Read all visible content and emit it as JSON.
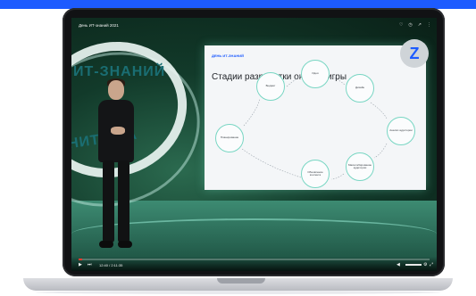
{
  "video": {
    "title": "День ИТ-знаний 2021",
    "time": "12:40 / 2:11:35",
    "progress_fraction": 0.01
  },
  "scene": {
    "ring_text_top": "ИТ-ЗНАНИЙ",
    "ring_text_bottom": "НИТ-ЗНА"
  },
  "slide": {
    "brand": "ДЕНЬ ИТ-ЗНАНИЙ",
    "title": "Стадии разработки онлайн-игры",
    "nodes": {
      "idea": "Идея",
      "budget": "Бюджет",
      "design": "Дизайн",
      "audience": "Анализ аудитории",
      "scaling": "Масштабирование аудитории",
      "updates": "Обновление контента",
      "planning": "Планирование"
    }
  },
  "icons": {
    "heart": "heart-icon",
    "clock": "clock-icon",
    "share": "share-icon",
    "more": "more-icon",
    "play": "play-icon",
    "next": "next-icon",
    "volume": "volume-icon",
    "settings": "settings-icon",
    "fullscreen": "fullscreen-icon"
  },
  "colors": {
    "accent": "#1d5bff",
    "progress": "#ff3b30",
    "node_border": "#78d6c3"
  }
}
